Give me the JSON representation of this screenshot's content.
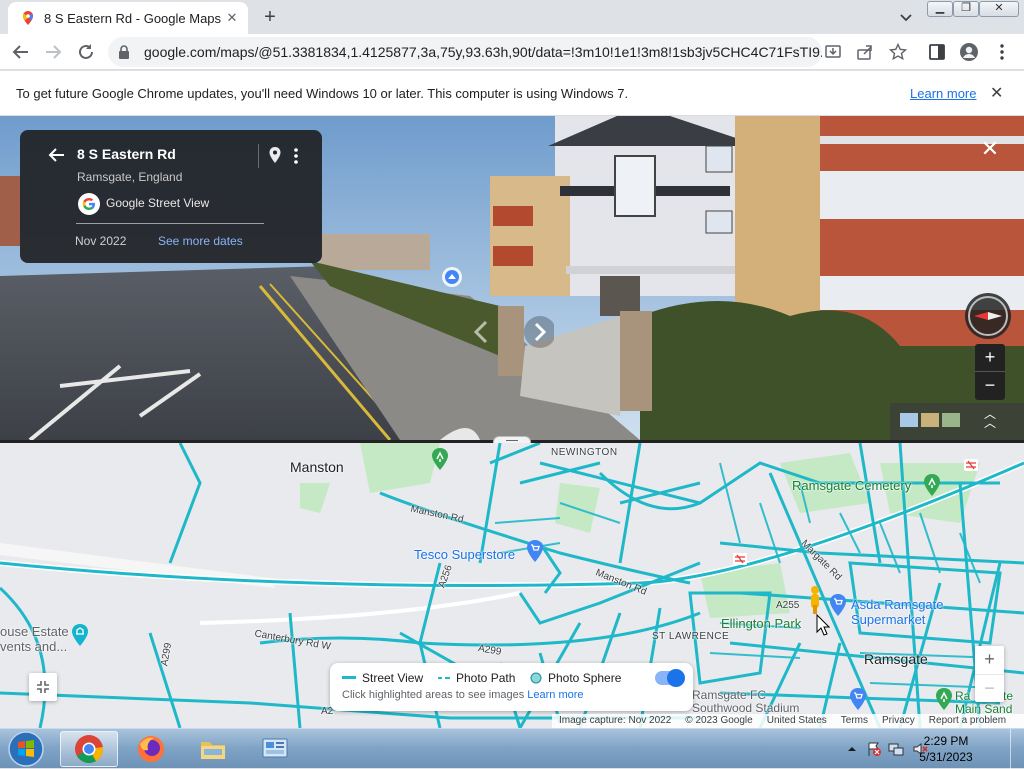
{
  "browser": {
    "tab_title": "8 S Eastern Rd - Google Maps",
    "new_tab_label": "+",
    "url": "google.com/maps/@51.3381834,1.4125877,3a,75y,93.63h,90t/data=!3m10!1e1!3m8!1sb3jv5CHC4C71FsTI9..."
  },
  "infobar": {
    "message": "To get future Google Chrome updates, you'll need Windows 10 or later. This computer is using Windows 7.",
    "learn_more": "Learn more"
  },
  "street_view": {
    "address": "8 S Eastern Rd",
    "locality": "Ramsgate, England",
    "source": "Google Street View",
    "capture_date": "Nov 2022",
    "see_more": "See more dates"
  },
  "map": {
    "labels": {
      "manston": "Manston",
      "newington": "NEWINGTON",
      "manston_rd_1": "Manston Rd",
      "manston_rd_2": "Manston Rd",
      "tesco": "Tesco Superstore",
      "ramsgate_cemetery": "Ramsgate Cemetery",
      "margate_rd": "Margate Rd",
      "a255": "A255",
      "a256": "A256",
      "a299_1": "A299",
      "a299_2": "A299",
      "a27": "A2",
      "canterbury_rd": "Canterbury Rd W",
      "ellington_park": "Ellington Park",
      "st_lawrence": "ST LAWRENCE",
      "asda": "Asda Ramsgate\nSupermarket",
      "ramsgate": "Ramsgate",
      "house_estate": "ouse Estate\nvents and...",
      "ramsgate_fc": "Ramsgate FC\nSouthwood Stadium",
      "ramsgate_main_sand": "Ra    sgate\nMain Sand"
    },
    "legend": {
      "street_view": "Street View",
      "photo_path": "Photo Path",
      "photo_sphere": "Photo Sphere",
      "hint": "Click highlighted areas to see images",
      "hint_link": "Learn more"
    },
    "attribution": {
      "capture": "Image capture: Nov 2022",
      "copyright": "© 2023 Google",
      "country": "United States",
      "terms": "Terms",
      "privacy": "Privacy",
      "report": "Report a problem"
    },
    "zoom_in": "+",
    "zoom_out": "−"
  },
  "taskbar": {
    "time": "2:29 PM",
    "date": "5/31/2023"
  },
  "colors": {
    "coverage_line": "#1fb8c9",
    "map_bg": "#e8eaed",
    "park": "#c5e8c5",
    "accent": "#1a73e8"
  }
}
